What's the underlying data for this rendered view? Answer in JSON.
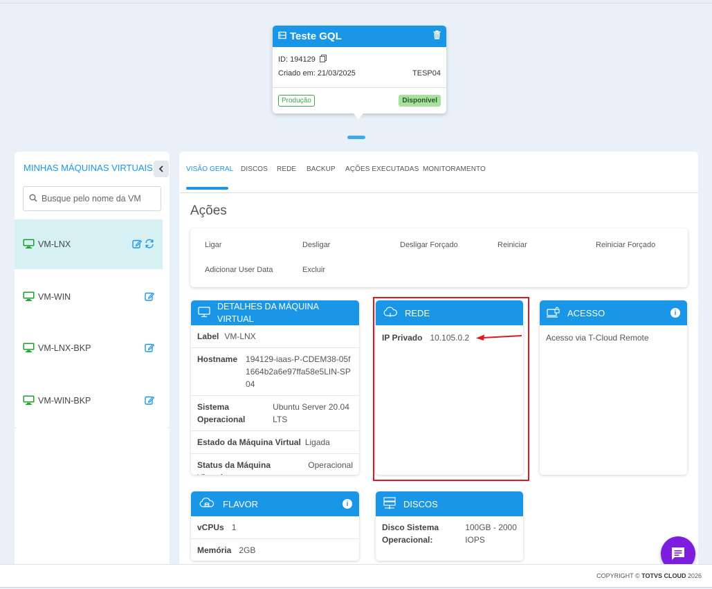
{
  "vm_card": {
    "title": "Teste GQL",
    "id_label": "ID: 194129",
    "created_label": "Criado em: 21/03/2025",
    "code": "TESP04",
    "env_badge": "Produção",
    "status_badge": "Disponível"
  },
  "sidebar": {
    "title": "MINHAS MÁQUINAS VIRTUAIS",
    "search_placeholder": "Busque pelo nome da VM",
    "items": [
      {
        "name": "VM-LNX"
      },
      {
        "name": "VM-WIN"
      },
      {
        "name": "VM-LNX-BKP"
      },
      {
        "name": "VM-WIN-BKP"
      }
    ]
  },
  "tabs": [
    "VISÃO GERAL",
    "DISCOS",
    "REDE",
    "BACKUP",
    "AÇÕES EXECUTADAS",
    "MONITORAMENTO"
  ],
  "acoes": {
    "title": "Ações",
    "items": [
      "Ligar",
      "Desligar",
      "Desligar Forçado",
      "Reiniciar",
      "Reiniciar Forçado",
      "Adicionar User Data",
      "Excluir"
    ]
  },
  "detalhes": {
    "title": "DETALHES DA MÁQUINA VIRTUAL",
    "rows": [
      {
        "k": "Label",
        "v": "VM-LNX"
      },
      {
        "k": "Hostname",
        "v": "194129-iaas-P-CDEM38-05f1664b2a6e97ffa58e5LIN-SP04"
      },
      {
        "k": "Sistema Operacional",
        "v": "Ubuntu Server 20.04 LTS"
      },
      {
        "k": "Estado da Máquina Virtual",
        "v": "Ligada"
      },
      {
        "k": "Status da Máquina Virtual",
        "v": "Operacional"
      }
    ]
  },
  "rede": {
    "title": "REDE",
    "ip_label": "IP Privado",
    "ip_value": "10.105.0.2"
  },
  "acesso": {
    "title": "ACESSO",
    "text": "Acesso via T-Cloud Remote"
  },
  "flavor": {
    "title": "FLAVOR",
    "rows": [
      {
        "k": "vCPUs",
        "v": "1"
      },
      {
        "k": "Memória",
        "v": "2GB"
      }
    ]
  },
  "discos": {
    "title": "DISCOS",
    "label": "Disco Sistema Operacional:",
    "value": "100GB - 2000 IOPS"
  },
  "footer": {
    "copyright_prefix": "COPYRIGHT © ",
    "brand": "TOTVS CLOUD",
    "year": " 2026"
  },
  "colors": {
    "primary": "#1a96e6",
    "highlight": "#e0171f",
    "vm_icon": "#1aa32a",
    "chat": "#7d1de0"
  }
}
